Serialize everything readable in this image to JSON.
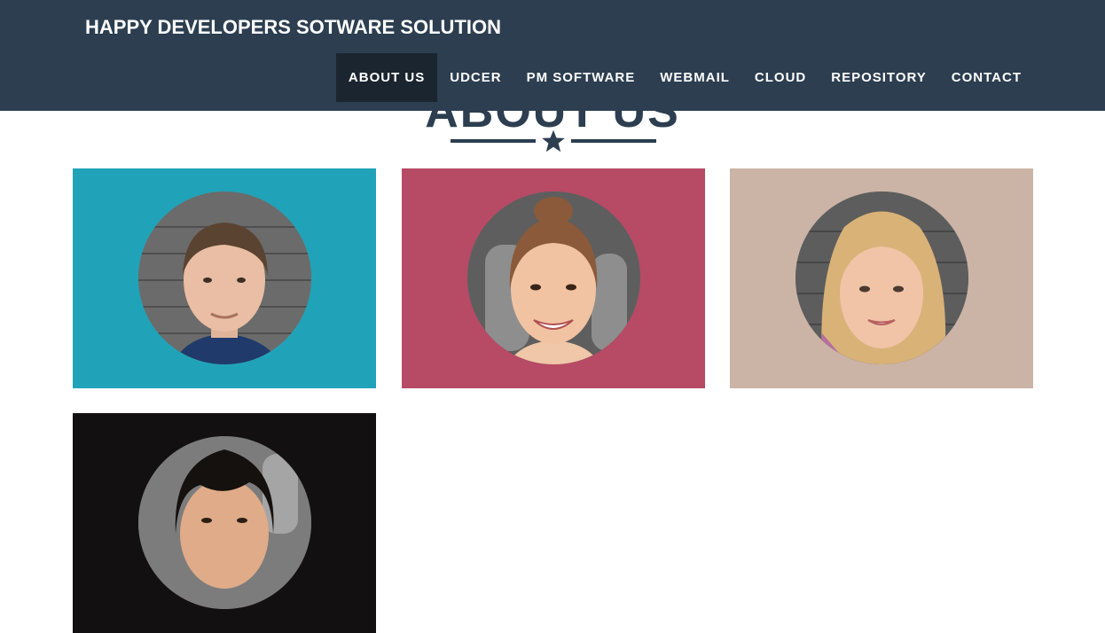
{
  "header": {
    "brand": "HAPPY DEVELOPERS SOTWARE SOLUTION",
    "nav": [
      {
        "label": "ABOUT US",
        "active": true
      },
      {
        "label": "UDCER",
        "active": false
      },
      {
        "label": "PM SOFTWARE",
        "active": false
      },
      {
        "label": "WEBMAIL",
        "active": false
      },
      {
        "label": "CLOUD",
        "active": false
      },
      {
        "label": "REPOSITORY",
        "active": false
      },
      {
        "label": "CONTACT",
        "active": false
      }
    ]
  },
  "section": {
    "title": "ABOUT US",
    "divider_icon": "star-icon"
  },
  "team": [
    {
      "card_color": "#20a3b8",
      "avatar_icon": "person-photo"
    },
    {
      "card_color": "#b74a65",
      "avatar_icon": "person-photo"
    },
    {
      "card_color": "#cbb4a6",
      "avatar_icon": "person-photo"
    },
    {
      "card_color": "#121010",
      "avatar_icon": "person-photo"
    }
  ],
  "colors": {
    "navbar": "#2c3e50",
    "nav_active": "#1a252f",
    "accent": "#2c3e50"
  }
}
